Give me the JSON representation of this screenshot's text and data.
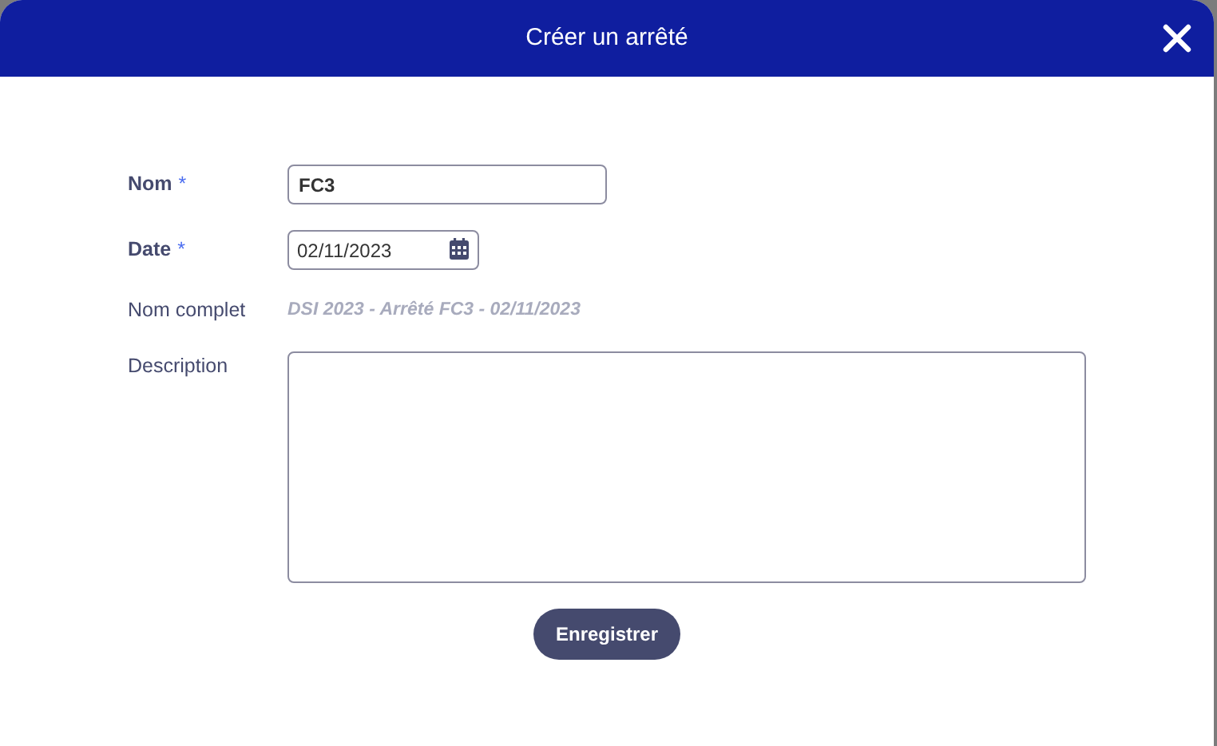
{
  "dialog": {
    "title": "Créer un arrêté"
  },
  "fields": [
    {
      "kind": "text",
      "label": "Nom",
      "required_mark": "*",
      "value": "FC3"
    },
    {
      "kind": "date",
      "label": "Date",
      "required_mark": "*",
      "value": "02/11/2023"
    },
    {
      "kind": "readonly",
      "label": "Nom complet",
      "value": "DSI 2023 - Arrêté FC3 - 02/11/2023"
    },
    {
      "kind": "textarea",
      "label": "Description"
    }
  ],
  "buttons": [
    "Enregistrer"
  ]
}
